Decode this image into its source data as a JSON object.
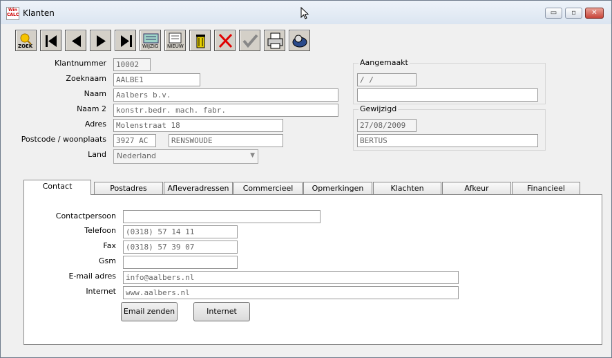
{
  "window": {
    "title": "Klanten",
    "icon_text": "Win CALC"
  },
  "window_controls": {
    "minimize": "▭",
    "maximize": "▫",
    "close": "✕"
  },
  "toolbar": {
    "zoek": "ZOEK",
    "wijzig": "WIJZIG",
    "nieuw": "NIEUW"
  },
  "form": {
    "klantnummer": {
      "label": "Klantnummer",
      "value": "10002"
    },
    "zoeknaam": {
      "label": "Zoeknaam",
      "value": "AALBE1"
    },
    "naam": {
      "label": "Naam",
      "value": "Aalbers b.v."
    },
    "naam2": {
      "label": "Naam 2",
      "value": "konstr.bedr.  mach. fabr."
    },
    "adres": {
      "label": "Adres",
      "value": "Molenstraat 18"
    },
    "postcode": {
      "label": "Postcode / woonplaats",
      "postcode": "3927 AC",
      "woonplaats": "RENSWOUDE"
    },
    "land": {
      "label": "Land",
      "value": "Nederland"
    }
  },
  "aangemaakt": {
    "title": "Aangemaakt",
    "date": " /  / ",
    "user": ""
  },
  "gewijzigd": {
    "title": "Gewijzigd",
    "date": "27/08/2009",
    "user": "BERTUS"
  },
  "tabs": [
    "Contact",
    "Postadres",
    "Afleveradressen",
    "Commercieel",
    "Opmerkingen",
    "Klachten",
    "Afkeur",
    "Financieel"
  ],
  "contact": {
    "contactpersoon": {
      "label": "Contactpersoon",
      "value": ""
    },
    "telefoon": {
      "label": "Telefoon",
      "value": "(0318) 57 14 11"
    },
    "fax": {
      "label": "Fax",
      "value": "(0318) 57 39 07"
    },
    "gsm": {
      "label": "Gsm",
      "value": ""
    },
    "email": {
      "label": "E-mail adres",
      "value": "info@aalbers.nl"
    },
    "internet": {
      "label": "Internet",
      "value": "www.aalbers.nl"
    }
  },
  "buttons": {
    "email": "Email zenden",
    "internet": "Internet"
  }
}
